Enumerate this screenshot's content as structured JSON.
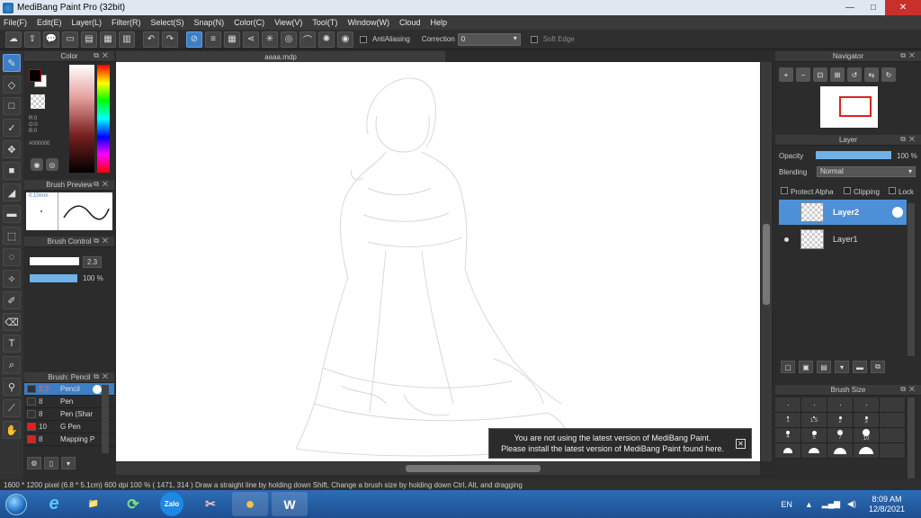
{
  "window": {
    "title": "MediBang Paint Pro (32bit)",
    "min": "—",
    "max": "□",
    "close": "✕"
  },
  "menu": [
    "File(F)",
    "Edit(E)",
    "Layer(L)",
    "Filter(R)",
    "Select(S)",
    "Snap(N)",
    "Color(C)",
    "View(V)",
    "Tool(T)",
    "Window(W)",
    "Cloud",
    "Help"
  ],
  "toolbar": {
    "antialiasing_label": "AntiAliasing",
    "correction_label": "Correction",
    "correction_value": "0",
    "softedge_label": "Soft Edge"
  },
  "color_panel": {
    "title": "Color",
    "r": "R:0",
    "g": "G:0",
    "b": "B:0",
    "hex": "#000000",
    "fg_color": "#000000",
    "bg_color": "#ffffff"
  },
  "brush_preview": {
    "title": "Brush Preview",
    "size": "0.10mm"
  },
  "brush_control": {
    "title": "Brush Control",
    "size_value": "2.3",
    "opacity_value": "100 %"
  },
  "brush_list": {
    "title": "Brush: Pencil",
    "items": [
      {
        "size": "2.3",
        "name": "Pencil",
        "selected": true,
        "color": "#333333"
      },
      {
        "size": "8",
        "name": "Pen",
        "selected": false,
        "color": "#333333"
      },
      {
        "size": "8",
        "name": "Pen (Shar",
        "selected": false,
        "color": "#333333"
      },
      {
        "size": "10",
        "name": "G Pen",
        "selected": false,
        "color": "#e02020"
      },
      {
        "size": "8",
        "name": "Mapping P",
        "selected": false,
        "color": "#e02020"
      }
    ]
  },
  "document": {
    "tab": "aaaa.mdp"
  },
  "notification": {
    "line1": "You are not using the latest version of MediBang Paint.",
    "line2": "Please install the latest version of MediBang Paint found here."
  },
  "navigator": {
    "title": "Navigator"
  },
  "layer_panel": {
    "title": "Layer",
    "opacity_label": "Opacity",
    "opacity_value": "100 %",
    "blending_label": "Blending",
    "blending_value": "Normal",
    "protect_alpha": "Protect Alpha",
    "clipping": "Clipping",
    "lock": "Lock",
    "layers": [
      {
        "name": "Layer2",
        "selected": true
      },
      {
        "name": "Layer1",
        "selected": false
      }
    ]
  },
  "brush_size_panel": {
    "title": "Brush Size",
    "sizes": [
      "",
      "",
      "",
      "",
      "",
      "1",
      "1.5",
      "2",
      "3",
      "",
      "4",
      "5",
      "7",
      "10",
      ""
    ]
  },
  "status": {
    "text": "1600 * 1200 pixel   (6.8 * 5.1cm)   600 dpi   100 %    ( 1471, 314 )   Draw a straight line by holding down Shift, Change a brush size by holding down Ctrl, Alt, and dragging"
  },
  "taskbar": {
    "apps": [
      "e",
      "📁",
      "⟳",
      "Zalo",
      "✂",
      "●",
      "W"
    ],
    "language": "EN",
    "time": "8:09 AM",
    "date": "12/8/2021"
  },
  "colors": {
    "accent": "#3d7fc6",
    "panel": "#2c2c2c",
    "highlight": "#6fb2ea"
  }
}
